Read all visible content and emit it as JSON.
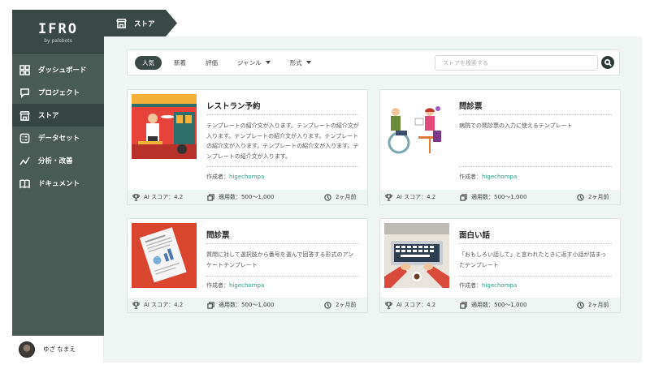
{
  "brand": {
    "title": "IFRO",
    "subtitle": "by palsbots"
  },
  "nav": [
    {
      "label": "ダッシュボード",
      "icon": "grid-icon"
    },
    {
      "label": "プロジェクト",
      "icon": "chat-bubble-icon"
    },
    {
      "label": "ストア",
      "icon": "store-icon",
      "active": true
    },
    {
      "label": "データセット",
      "icon": "dataset-icon"
    },
    {
      "label": "分析・改善",
      "icon": "trend-line-icon"
    },
    {
      "label": "ドキュメント",
      "icon": "book-icon"
    }
  ],
  "user": {
    "name": "ゆざ なまえ"
  },
  "breadcrumb": {
    "label": "ストア",
    "icon": "store-icon"
  },
  "filters": {
    "tabs": [
      {
        "label": "人気",
        "active": true
      },
      {
        "label": "新着"
      },
      {
        "label": "評価"
      },
      {
        "label": "ジャンル",
        "dropdown": true
      },
      {
        "label": "形式",
        "dropdown": true
      }
    ],
    "search_placeholder": "ストアを検索する"
  },
  "cards": [
    {
      "title": "レストラン予約",
      "description": "テンプレートの紹介文が入ります。テンプレートの紹介文が入ります。テンプレートの紹介文が入ります。テンプレートの紹介文が入ります。テンプレートの紹介文が入ります。テンプレートの紹介文が入ります。",
      "author_label": "作成者：",
      "author": "higechompa",
      "ai_score": "AI スコア：4.2",
      "usage": "適用数：500〜1,000",
      "time": "2ヶ月前",
      "image": "restaurant-illustration"
    },
    {
      "title": "問診票",
      "description": "病院での問診票の入力に使えるテンプレート",
      "author_label": "作成者：",
      "author": "higechompa",
      "ai_score": "AI スコア：4.2",
      "usage": "適用数：500〜1,000",
      "time": "2ヶ月前",
      "image": "medical-consultation-illustration"
    },
    {
      "title": "問診票",
      "description": "質問に対して選択肢から番号を選んで回答する形式のアンケートテンプレート",
      "author_label": "作成者：",
      "author": "higechompa",
      "ai_score": "AI スコア：4.2",
      "usage": "適用数：500〜1,000",
      "time": "2ヶ月前",
      "image": "document-report-illustration"
    },
    {
      "title": "面白い話",
      "description": "「おもしろい話して」と言われたときに返す小話が詰まったテンプレート",
      "author_label": "作成者：",
      "author": "higechompa",
      "ai_score": "AI スコア：4.2",
      "usage": "適用数：500〜1,000",
      "time": "2ヶ月前",
      "image": "laptop-desk-illustration"
    }
  ],
  "colors": {
    "sidebar": "#4a5a55",
    "sidebar_dark": "#3a4945",
    "accent_green": "#2a9a82",
    "main_bg": "#eef5f3"
  }
}
